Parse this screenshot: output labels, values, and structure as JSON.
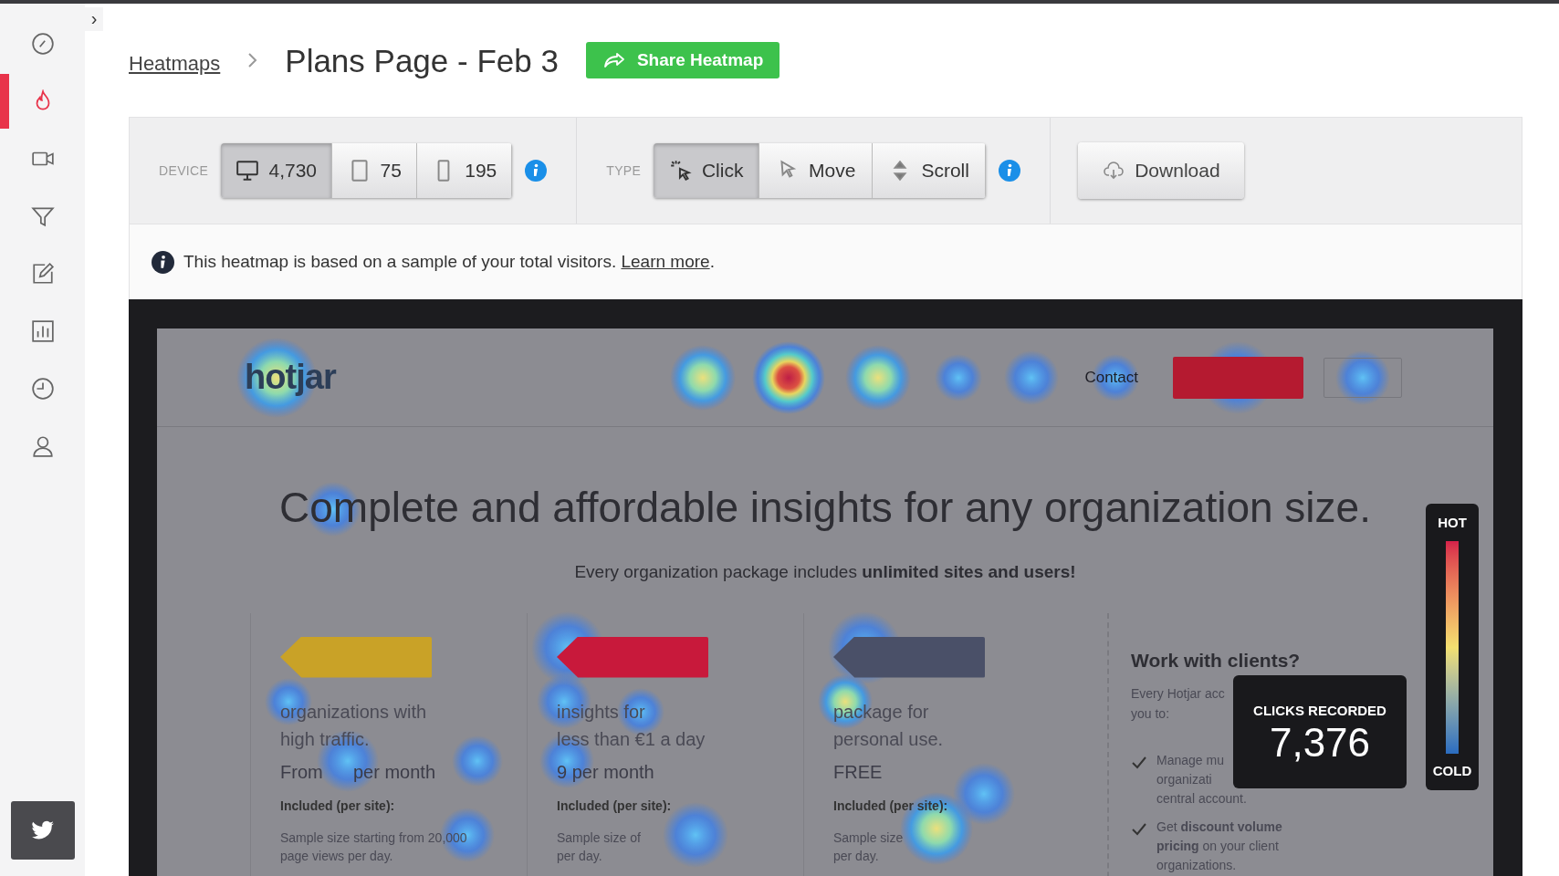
{
  "sidebar": {
    "toggle": "›",
    "items": [
      {
        "kind": "gauge",
        "selected": false
      },
      {
        "kind": "flame",
        "selected": true
      },
      {
        "kind": "video",
        "selected": false
      },
      {
        "kind": "funnel",
        "selected": false
      },
      {
        "kind": "edit",
        "selected": false
      },
      {
        "kind": "chart",
        "selected": false
      },
      {
        "kind": "history",
        "selected": false
      },
      {
        "kind": "person",
        "selected": false
      }
    ],
    "footer_button": {
      "kind": "twitter"
    }
  },
  "breadcrumb": {
    "link": "Heatmaps",
    "title": "Plans Page - Feb 3",
    "share_button": "Share Heatmap"
  },
  "toolbar": {
    "device_label": "DEVICE",
    "devices": [
      {
        "kind": "desktop",
        "count": "4,730",
        "selected": true
      },
      {
        "kind": "tablet",
        "count": "75",
        "selected": false
      },
      {
        "kind": "phone",
        "count": "195",
        "selected": false
      }
    ],
    "type_label": "TYPE",
    "types": [
      {
        "kind": "click",
        "label": "Click",
        "selected": true
      },
      {
        "kind": "move",
        "label": "Move",
        "selected": false
      },
      {
        "kind": "scroll",
        "label": "Scroll",
        "selected": false
      }
    ],
    "download_button": "Download"
  },
  "notice": {
    "text": "This heatmap is based on a sample of your total visitors.",
    "link": "Learn more",
    "after": "."
  },
  "preview": {
    "logo": "hotjar",
    "nav_link": "Contact",
    "headline": "Complete and affordable insights for any organization size.",
    "subline": "Every organization package includes **unlimited sites and users!**",
    "plans": [
      {
        "color": "#c9a227",
        "lines": [
          "organizations with",
          "high traffic."
        ],
        "price": "From      per month",
        "included": "Included (per site):",
        "details": [
          "Sample size starting from 20,000",
          "page views per day."
        ]
      },
      {
        "color": "#c8193b",
        "lines": [
          "insights for",
          "less than €1 a day"
        ],
        "price": "9 per month",
        "included": "Included (per site):",
        "details": [
          "Sample size of",
          "per day."
        ]
      },
      {
        "color": "#4a5068",
        "lines": [
          "package for",
          "personal use."
        ],
        "price": "FREE",
        "included": "Included (per site):",
        "details": [
          "Sample size",
          "per day."
        ]
      }
    ],
    "clients": {
      "title": "Work with clients?",
      "intro": [
        "Every Hotjar acc",
        "you to:"
      ],
      "points": [
        {
          "lines": [
            "Manage mu",
            "organizati",
            "central account."
          ]
        },
        {
          "lines": [
            "Get **discount volume**",
            "**pricing** on your client",
            "organizations."
          ]
        }
      ]
    }
  },
  "clicks": {
    "label": "CLICKS RECORDED",
    "value": "7,376"
  },
  "legend": {
    "hot": "HOT",
    "cold": "COLD"
  }
}
